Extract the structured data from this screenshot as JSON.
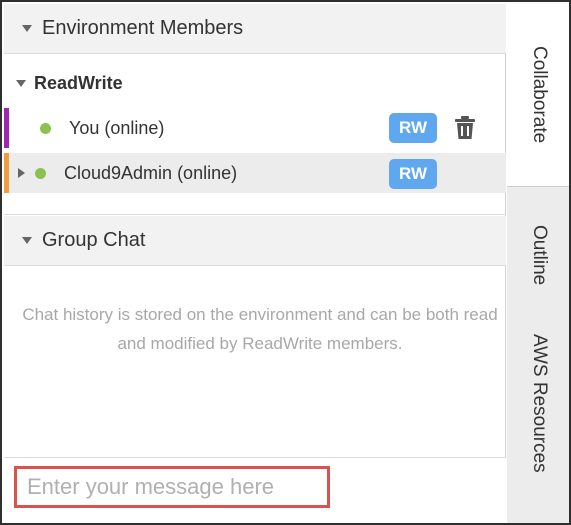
{
  "members_section": {
    "header": "Environment Members",
    "group_label": "ReadWrite",
    "members": [
      {
        "name": "You (online)",
        "badge": "RW",
        "status_color": "#8cc152",
        "bar_color": "#9c27b0"
      },
      {
        "name": "Cloud9Admin (online)",
        "badge": "RW",
        "status_color": "#8cc152",
        "bar_color": "#f39c3d"
      }
    ]
  },
  "chat_section": {
    "header": "Group Chat",
    "note": "Chat history is stored on the environment and can be both read and modified by ReadWrite members.",
    "input_placeholder": "Enter your message here"
  },
  "side_tabs": [
    "Collaborate",
    "Outline",
    "AWS Resources"
  ],
  "colors": {
    "rw_badge": "#5fa8f0",
    "highlight_border": "#d9534f"
  }
}
